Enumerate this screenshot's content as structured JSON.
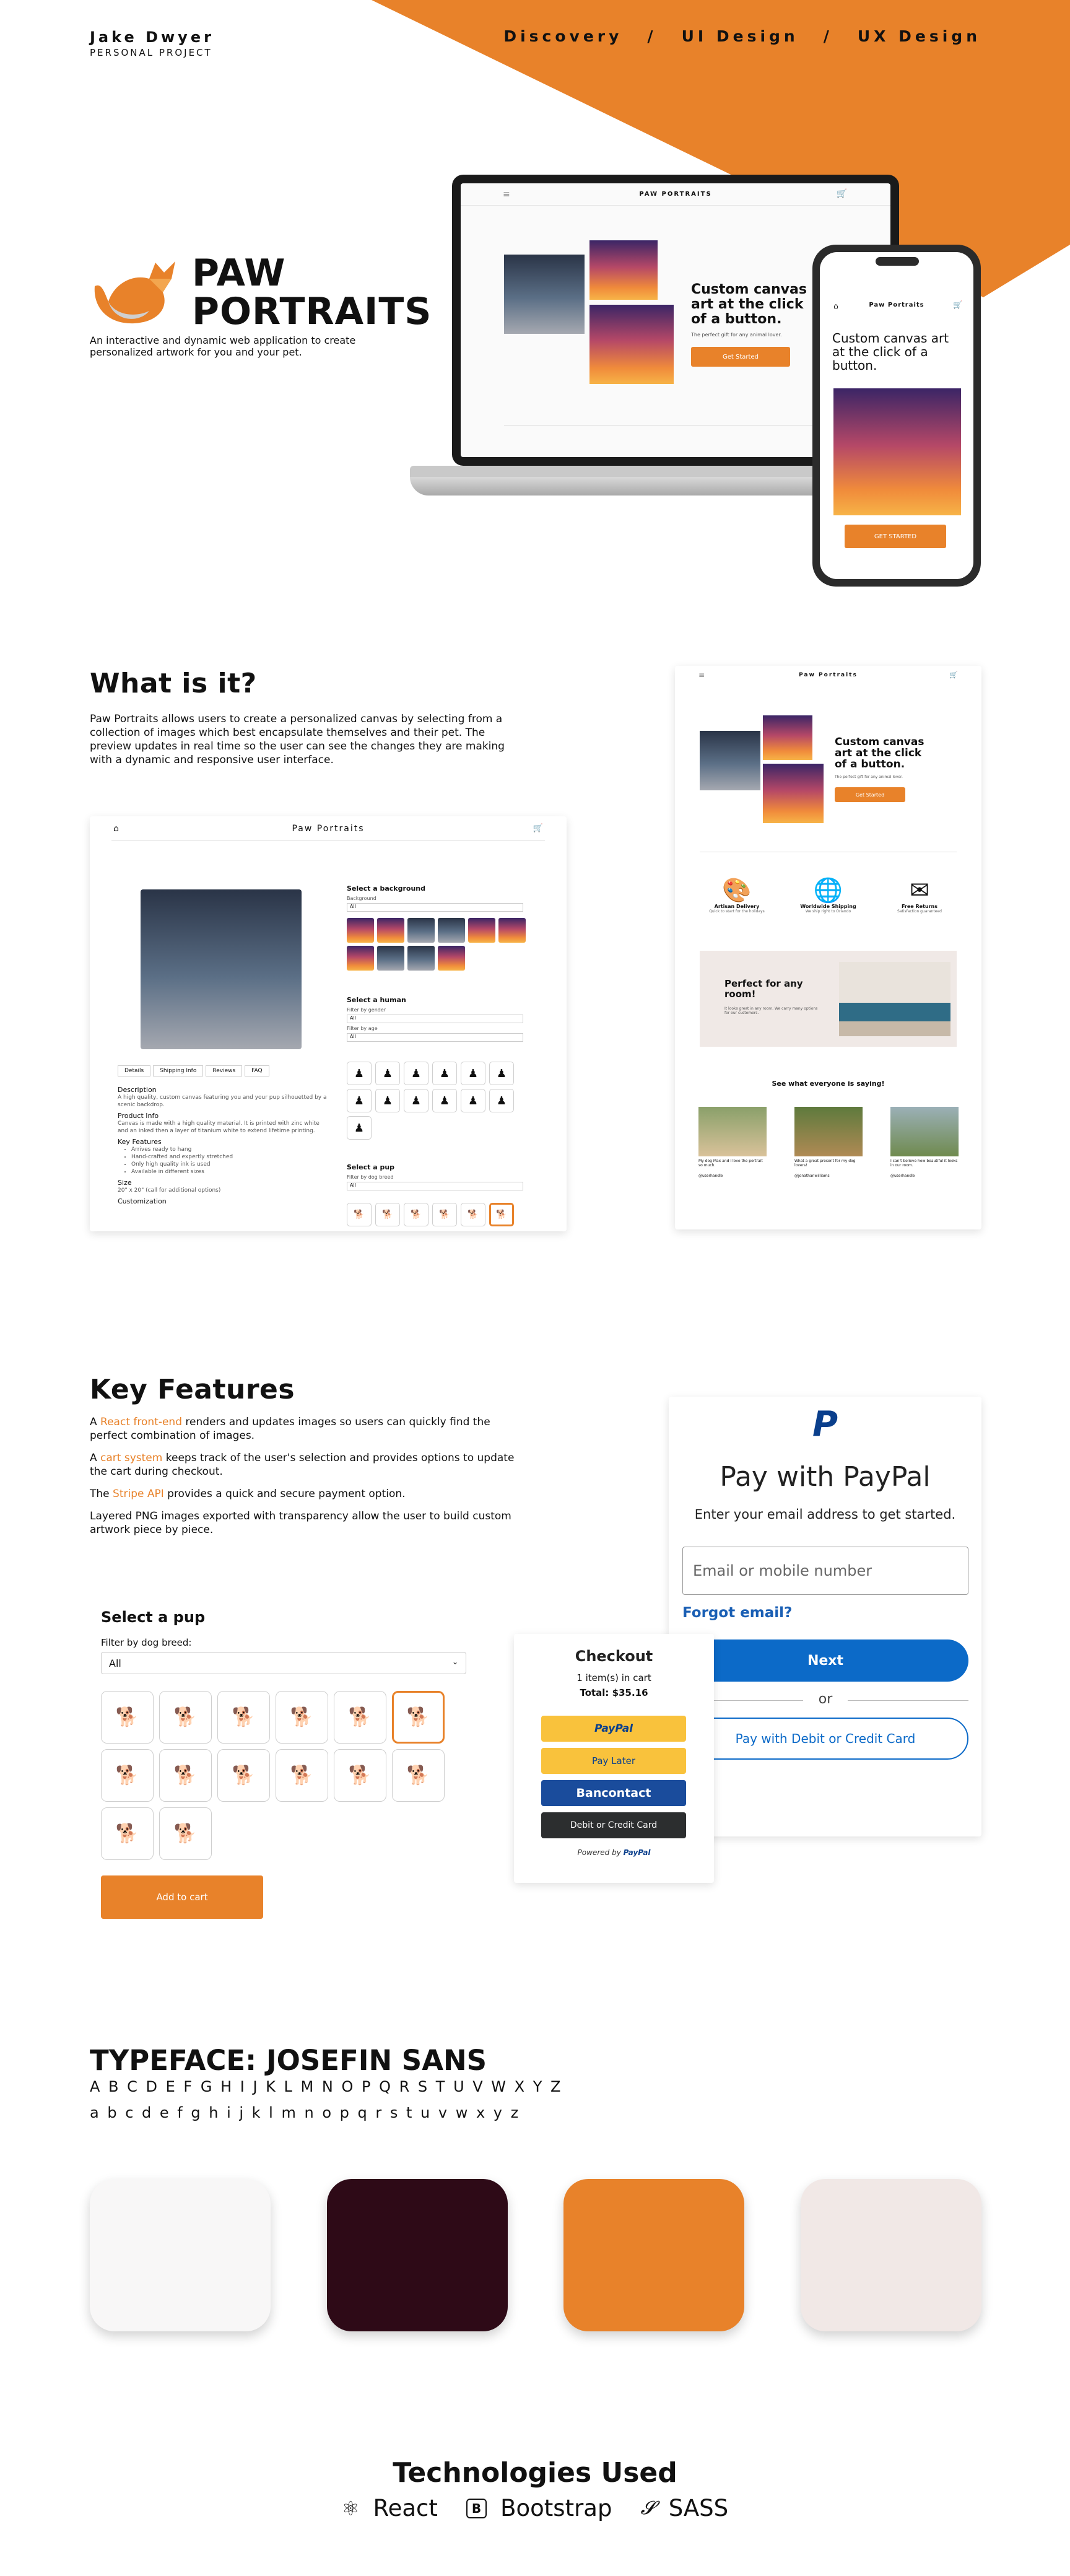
{
  "header": {
    "name": "Jake Dwyer",
    "subtitle": "PERSONAL PROJECT",
    "nav": [
      "Discovery",
      "/",
      "UI Design",
      "/",
      "UX Design"
    ]
  },
  "hero": {
    "logo_line1": "PAW",
    "logo_line2": "PORTRAITS",
    "description": "An interactive and dynamic web application to create personalized artwork for you and your pet.",
    "laptop": {
      "brand": "PAW PORTRAITS",
      "headline": "Custom canvas art at the click of a button.",
      "tagline": "The perfect gift for any animal lover.",
      "cta": "Get Started"
    },
    "phone": {
      "brand": "Paw Portraits",
      "headline": "Custom canvas art at the click of a button.",
      "cta": "GET STARTED"
    }
  },
  "what": {
    "title": "What is it?",
    "body": "Paw Portraits allows users to create a personalized canvas by selecting from a collection of images which best encapsulate themselves and their pet. The preview updates in real time so the user can see the changes they are making with a dynamic and responsive user interface.",
    "builder": {
      "brand": "Paw Portraits",
      "select_background": "Select a background",
      "bg_filter_label": "Background",
      "bg_filter_value": "All",
      "select_human": "Select a human",
      "gender_label": "Filter by gender",
      "gender_value": "All",
      "age_label": "Filter by age",
      "age_value": "All",
      "select_pup": "Select a pup",
      "breed_label": "Filter by dog breed",
      "breed_value": "All",
      "tabs": [
        "Details",
        "Shipping Info",
        "Reviews",
        "FAQ"
      ],
      "desc_title": "Description",
      "desc_text": "A high quality, custom canvas featuring you and your pup silhouetted by a scenic backdrop.",
      "info_title": "Product Info",
      "info_text": "Canvas is made with a high quality material. It is printed with zinc white and an inked then a layer of titanium white to extend lifetime printing.",
      "features_title": "Key Features",
      "features": [
        "Arrives ready to hang",
        "Hand-crafted and expertly stretched",
        "Only high quality ink is used",
        "Available in different sizes"
      ],
      "size_title": "Size",
      "size_text": "20\" x 20\" (call for additional options)",
      "custom_title": "Customization"
    },
    "home": {
      "brand": "Paw Portraits",
      "headline": "Custom canvas art at the click of a button.",
      "tagline": "The perfect gift for any animal lover.",
      "cta": "Get Started",
      "features": [
        {
          "icon": "palette-icon",
          "title": "Artisan Delivery",
          "text": "Quick to start for the holidays"
        },
        {
          "icon": "globe-icon",
          "title": "Worldwide Shipping",
          "text": "We ship right to Orlando"
        },
        {
          "icon": "envelope-icon",
          "title": "Free Returns",
          "text": "Satisfaction guaranteed"
        }
      ],
      "promo_title": "Perfect for any room!",
      "promo_text": "It looks great in any room. We carry many options for our customers.",
      "testimonials_title": "See what everyone is saying!",
      "testimonials": [
        {
          "text": "My dog Max and I love the portrait so much.",
          "handle": "@userhandle"
        },
        {
          "text": "What a great present for my dog lovers!",
          "handle": "@jonathanwilliams"
        },
        {
          "text": "I can't believe how beautiful it looks in our room.",
          "handle": "@userhandle"
        }
      ]
    }
  },
  "features": {
    "title": "Key Features",
    "p1_pre": "A ",
    "p1_hl": "React front-end",
    "p1_post": " renders and updates images so users can quickly find the perfect combination of images.",
    "p2_pre": "A ",
    "p2_hl": "cart system",
    "p2_post": " keeps track of the user's selection and provides options to update the cart during checkout.",
    "p3_pre": "The ",
    "p3_hl": "Stripe API",
    "p3_post": " provides a quick and secure payment option.",
    "p4": "Layered PNG images exported with transparency allow the user to build custom artwork piece by piece.",
    "pup": {
      "title": "Select a pup",
      "filter_label": "Filter by dog breed:",
      "filter_value": "All",
      "add_to_cart": "Add to cart",
      "selected_index": 5
    },
    "checkout": {
      "title": "Checkout",
      "items": "1 item(s) in cart",
      "total": "Total: $35.16",
      "paypal": "PayPal",
      "paylater": "Pay Later",
      "bancontact": "Bancontact",
      "card": "Debit or Credit Card",
      "powered": "Powered by",
      "powered_brand": "PayPal"
    },
    "paypal": {
      "title": "Pay with PayPal",
      "subtitle": "Enter your email address to get started.",
      "email_placeholder": "Email or mobile number",
      "forgot": "Forgot email?",
      "next": "Next",
      "or": "or",
      "card_button": "Pay with Debit or Credit Card"
    }
  },
  "typeface": {
    "title": "TYPEFACE: JOSEFIN SANS",
    "upper": "A B C D E F G H I J K L M N O P Q R S T U V W X Y Z",
    "lower": "a b c d e f g h i j k l m n o p q r s t u v w x y z"
  },
  "palette": {
    "colors": [
      "#f8f7f7",
      "#2e0a17",
      "#e8822a",
      "#f1e8e6"
    ]
  },
  "tech": {
    "title": "Technologies Used",
    "items": [
      {
        "icon": "react-icon",
        "label": "React"
      },
      {
        "icon": "bootstrap-icon",
        "label": "Bootstrap"
      },
      {
        "icon": "sass-icon",
        "label": "SASS"
      }
    ]
  },
  "accent": "#e8822a"
}
